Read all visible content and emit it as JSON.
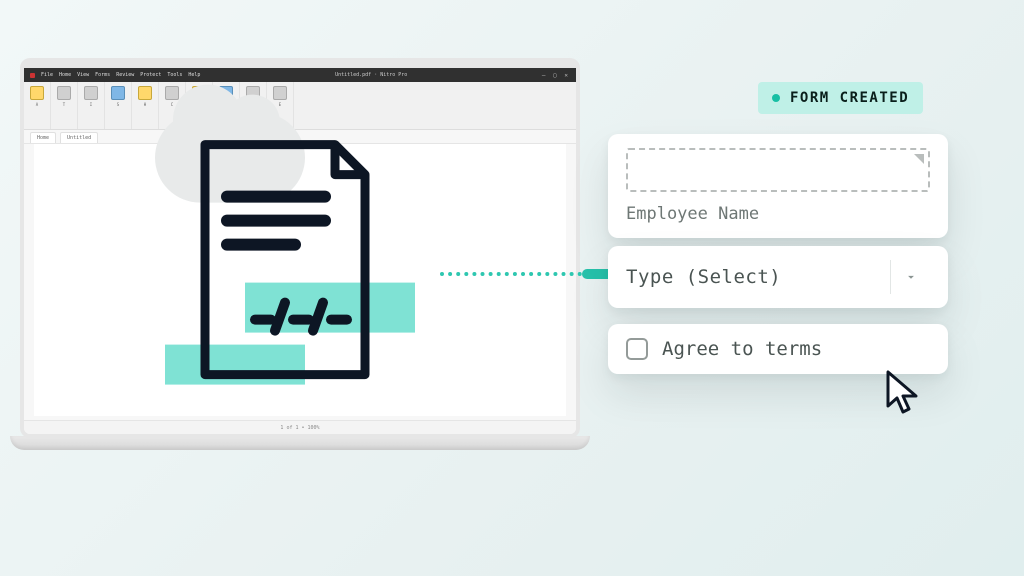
{
  "badge": {
    "text": "FORM CREATED"
  },
  "fields": {
    "employee_name": {
      "label": "Employee Name"
    },
    "type_select": {
      "label": "Type (Select)"
    },
    "agree_terms": {
      "label": "Agree to terms"
    }
  },
  "doc": {
    "date_glyph": "_/_/_"
  },
  "app": {
    "title": "Untitled.pdf · Nitro Pro",
    "menu": [
      "File",
      "Home",
      "View",
      "Forms",
      "Review",
      "Protect",
      "Tools",
      "Help"
    ],
    "tabs": [
      "Home",
      "Untitled"
    ],
    "statusbar": "1 of 1  •  100%"
  }
}
